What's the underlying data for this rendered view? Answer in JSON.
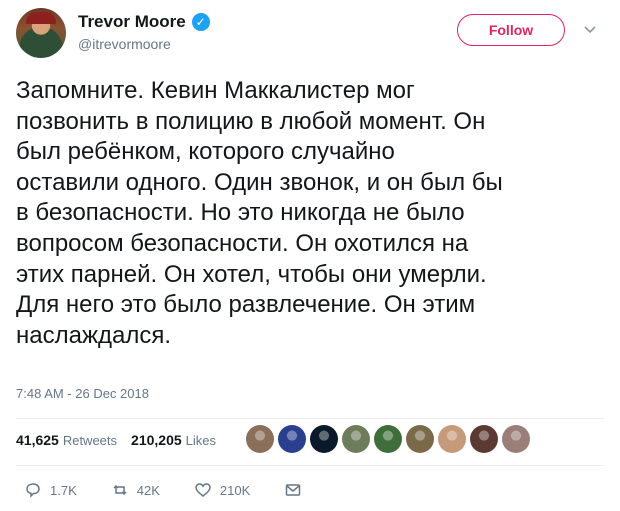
{
  "user": {
    "name": "Trevor Moore",
    "handle": "@itrevormoore",
    "verified_mark": "✓"
  },
  "follow_label": "Follow",
  "tweet": {
    "text": "Запомните. Кевин Маккалистер мог\nпозвонить в полицию в любой момент. Он\nбыл ребёнком, которого случайно\nоставили одного. Один звонок, и он был бы\nв безопасности. Но это никогда не было\nвопросом безопасности. Он охотился на\nэтих парней. Он хотел, чтобы они умерли.\nДля него это было развлечение. Он этим\nнаслаждался.",
    "timestamp": "7:48 AM - 26 Dec 2018"
  },
  "stats": {
    "retweets_count": "41,625",
    "retweets_label": "Retweets",
    "likes_count": "210,205",
    "likes_label": "Likes"
  },
  "likers": [
    {
      "icon": "avatar-1",
      "color": "#8a6f5a"
    },
    {
      "icon": "avatar-2",
      "color": "#2b3f8f"
    },
    {
      "icon": "avatar-3",
      "color": "#0b1a2a"
    },
    {
      "icon": "avatar-4",
      "color": "#6d7d5c"
    },
    {
      "icon": "avatar-5",
      "color": "#3f6e3a"
    },
    {
      "icon": "avatar-6",
      "color": "#7a6a4a"
    },
    {
      "icon": "avatar-7",
      "color": "#c49a7a"
    },
    {
      "icon": "avatar-8",
      "color": "#5a3a33"
    },
    {
      "icon": "avatar-9",
      "color": "#9a7e78"
    }
  ],
  "actions": {
    "replies": "1.7K",
    "retweets": "42K",
    "likes": "210K"
  },
  "colors": {
    "accent": "#e0245e",
    "verified": "#1da1f2",
    "muted": "#657786"
  }
}
